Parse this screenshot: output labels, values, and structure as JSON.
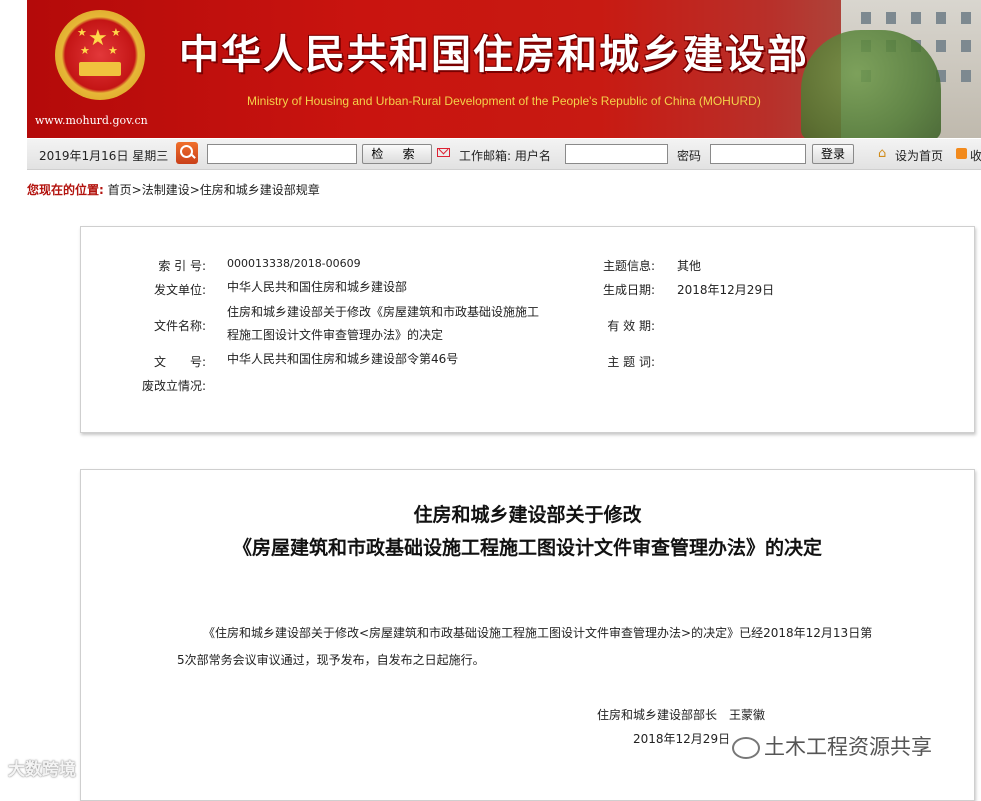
{
  "header": {
    "site_url": "www.mohurd.gov.cn",
    "title": "中华人民共和国住房和城乡建设部",
    "subtitle": "Ministry of Housing and Urban-Rural Development of the People's Republic of China (MOHURD)"
  },
  "toolbar": {
    "date": "2019年1月16日  星期三",
    "search_value": "",
    "search_button": "检 索",
    "mail_label": "工作邮箱: 用户名",
    "username_value": "",
    "password_label": "密码",
    "password_value": "",
    "login_button": "登录",
    "home_label": "设为首页",
    "favorite_label": "收"
  },
  "breadcrumb": {
    "prefix": "您现在的位置:",
    "items": [
      "首页",
      "法制建设",
      "住房和城乡建设部规章"
    ],
    "separator": ">"
  },
  "info": {
    "index_label": "索 引 号:",
    "index_value": "000013338/2018-00609",
    "issuer_label": "发文单位:",
    "issuer_value": "中华人民共和国住房和城乡建设部",
    "name_label": "文件名称:",
    "name_value": "住房和城乡建设部关于修改《房屋建筑和市政基础设施施工程施工图设计文件审查管理办法》的决定",
    "docno_label": "文　　号:",
    "docno_value": "中华人民共和国住房和城乡建设部令第46号",
    "status_label": "废改立情况:",
    "status_value": "",
    "topic_label": "主题信息:",
    "topic_value": "其他",
    "date_label": "生成日期:",
    "date_value": "2018年12月29日",
    "valid_label": "有 效 期:",
    "valid_value": "",
    "keywords_label": "主 题 词:",
    "keywords_value": ""
  },
  "document": {
    "title_line1": "住房和城乡建设部关于修改",
    "title_line2": "《房屋建筑和市政基础设施工程施工图设计文件审查管理办法》的决定",
    "body": "《住房和城乡建设部关于修改<房屋建筑和市政基础设施工程施工图设计文件审查管理办法>的决定》已经2018年12月13日第5次部常务会议审议通过，现予发布，自发布之日起施行。",
    "signature": "住房和城乡建设部部长　王蒙徽",
    "date": "2018年12月29日"
  },
  "watermarks": {
    "left": "大数跨境",
    "right": "土木工程资源共享"
  },
  "colors": {
    "banner_red": "#c9140f",
    "breadcrumb_prefix": "#b3140f",
    "subtitle_gold": "#f4d24a"
  }
}
